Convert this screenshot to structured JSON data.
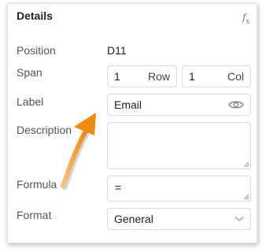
{
  "panel": {
    "title": "Details",
    "fx_symbol": "f",
    "fx_sub": "x"
  },
  "fields": {
    "position": {
      "label": "Position",
      "value": "D11"
    },
    "span": {
      "label": "Span",
      "rows": "1",
      "rows_unit": "Row",
      "cols": "1",
      "cols_unit": "Col"
    },
    "label": {
      "label": "Label",
      "value": "Email"
    },
    "description": {
      "label": "Description",
      "value": ""
    },
    "formula": {
      "label": "Formula",
      "value": "="
    },
    "format": {
      "label": "Format",
      "value": "General"
    }
  },
  "colors": {
    "arrow": "#f39a1e",
    "border": "#dcdcdc",
    "label_text": "#555555"
  },
  "icons": {
    "eye": "eye-icon",
    "chevron": "chevron-down-icon",
    "fx": "function-icon"
  }
}
